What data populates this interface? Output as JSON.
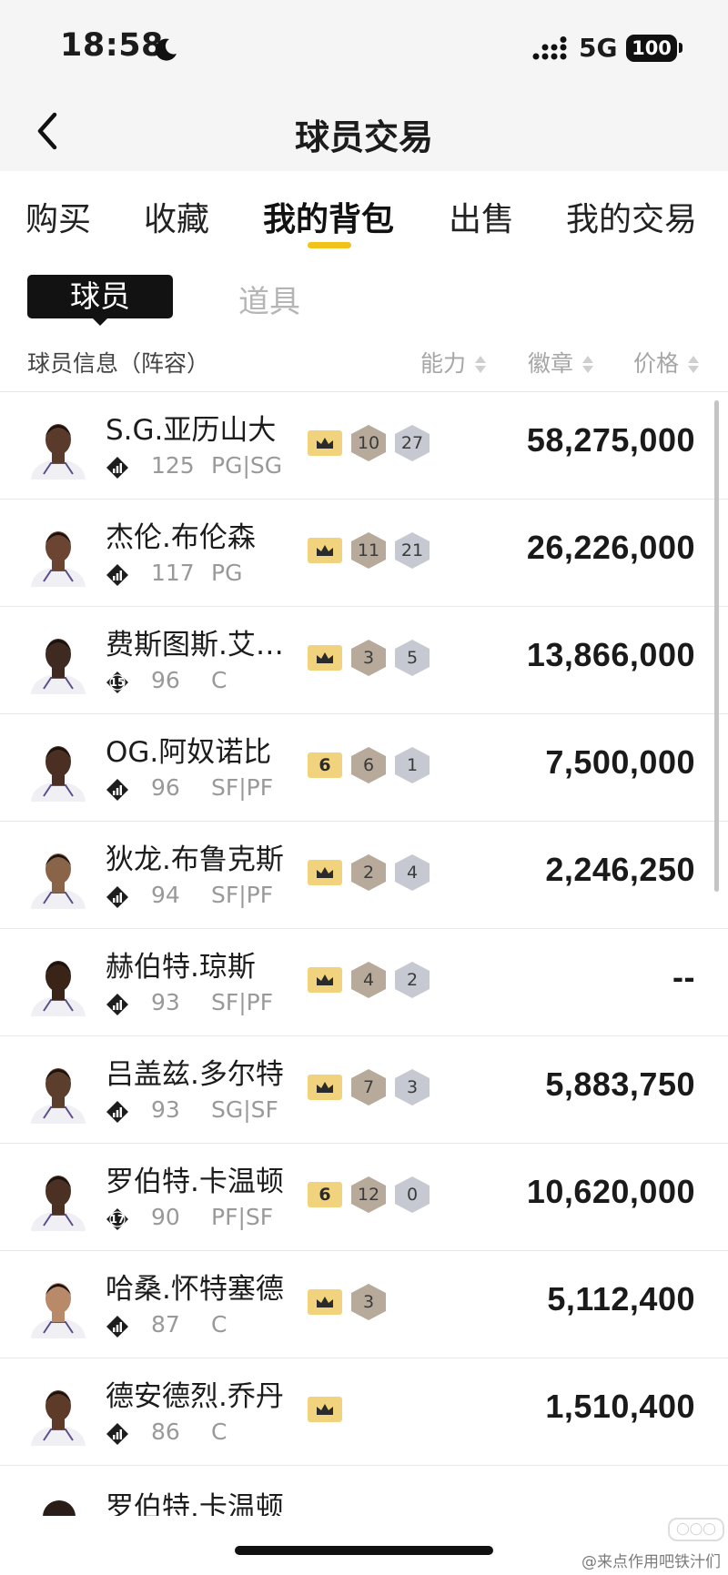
{
  "status_bar": {
    "time": "18:58",
    "network": "5G",
    "battery": "100"
  },
  "nav": {
    "title": "球员交易"
  },
  "tabs": [
    {
      "label": "购买"
    },
    {
      "label": "收藏"
    },
    {
      "label": "我的背包"
    },
    {
      "label": "出售"
    },
    {
      "label": "我的交易"
    }
  ],
  "active_tab": "我的背包",
  "segments": {
    "active": "球员",
    "inactive": "道具"
  },
  "columns": {
    "info": "球员信息（阵容）",
    "ability": "能力",
    "badges": "徽章",
    "price": "价格"
  },
  "players": [
    {
      "name": "S.G.亚历山大",
      "tier": "",
      "ovr": "125",
      "pos": "PG|SG",
      "gold": "crown",
      "bronze": "10",
      "silver": "27",
      "price": "58,275,000"
    },
    {
      "name": "杰伦.布伦森",
      "tier": "",
      "ovr": "117",
      "pos": "PG",
      "gold": "crown",
      "bronze": "11",
      "silver": "21",
      "price": "26,226,000"
    },
    {
      "name": "费斯图斯.艾…",
      "tier": "15",
      "ovr": "96",
      "pos": "C",
      "gold": "crown",
      "bronze": "3",
      "silver": "5",
      "price": "13,866,000"
    },
    {
      "name": "OG.阿奴诺比",
      "tier": "",
      "ovr": "96",
      "pos": "SF|PF",
      "gold": "6",
      "bronze": "6",
      "silver": "1",
      "price": "7,500,000"
    },
    {
      "name": "狄龙.布鲁克斯",
      "tier": "",
      "ovr": "94",
      "pos": "SF|PF",
      "gold": "crown",
      "bronze": "2",
      "silver": "4",
      "price": "2,246,250"
    },
    {
      "name": "赫伯特.琼斯",
      "tier": "",
      "ovr": "93",
      "pos": "SF|PF",
      "gold": "crown",
      "bronze": "4",
      "silver": "2",
      "price": "--"
    },
    {
      "name": "吕盖兹.多尔特",
      "tier": "",
      "ovr": "93",
      "pos": "SG|SF",
      "gold": "crown",
      "bronze": "7",
      "silver": "3",
      "price": "5,883,750"
    },
    {
      "name": "罗伯特.卡温顿",
      "tier": "17",
      "ovr": "90",
      "pos": "PF|SF",
      "gold": "6",
      "bronze": "12",
      "silver": "0",
      "price": "10,620,000"
    },
    {
      "name": "哈桑.怀特塞德",
      "tier": "",
      "ovr": "87",
      "pos": "C",
      "gold": "crown",
      "bronze": "3",
      "silver": "",
      "price": "5,112,400"
    },
    {
      "name": "德安德烈.乔丹",
      "tier": "",
      "ovr": "86",
      "pos": "C",
      "gold": "crown",
      "bronze": "",
      "silver": "",
      "price": "1,510,400"
    }
  ],
  "partial_row": {
    "name": "罗伯特.卡温顿"
  },
  "watermark": "@来点作用吧铁汁们",
  "colors": {
    "accent": "#f3c21a",
    "gold_badge": "#f1d37d",
    "bronze_badge": "#b7aa9a",
    "silver_badge": "#c6c9d1"
  }
}
